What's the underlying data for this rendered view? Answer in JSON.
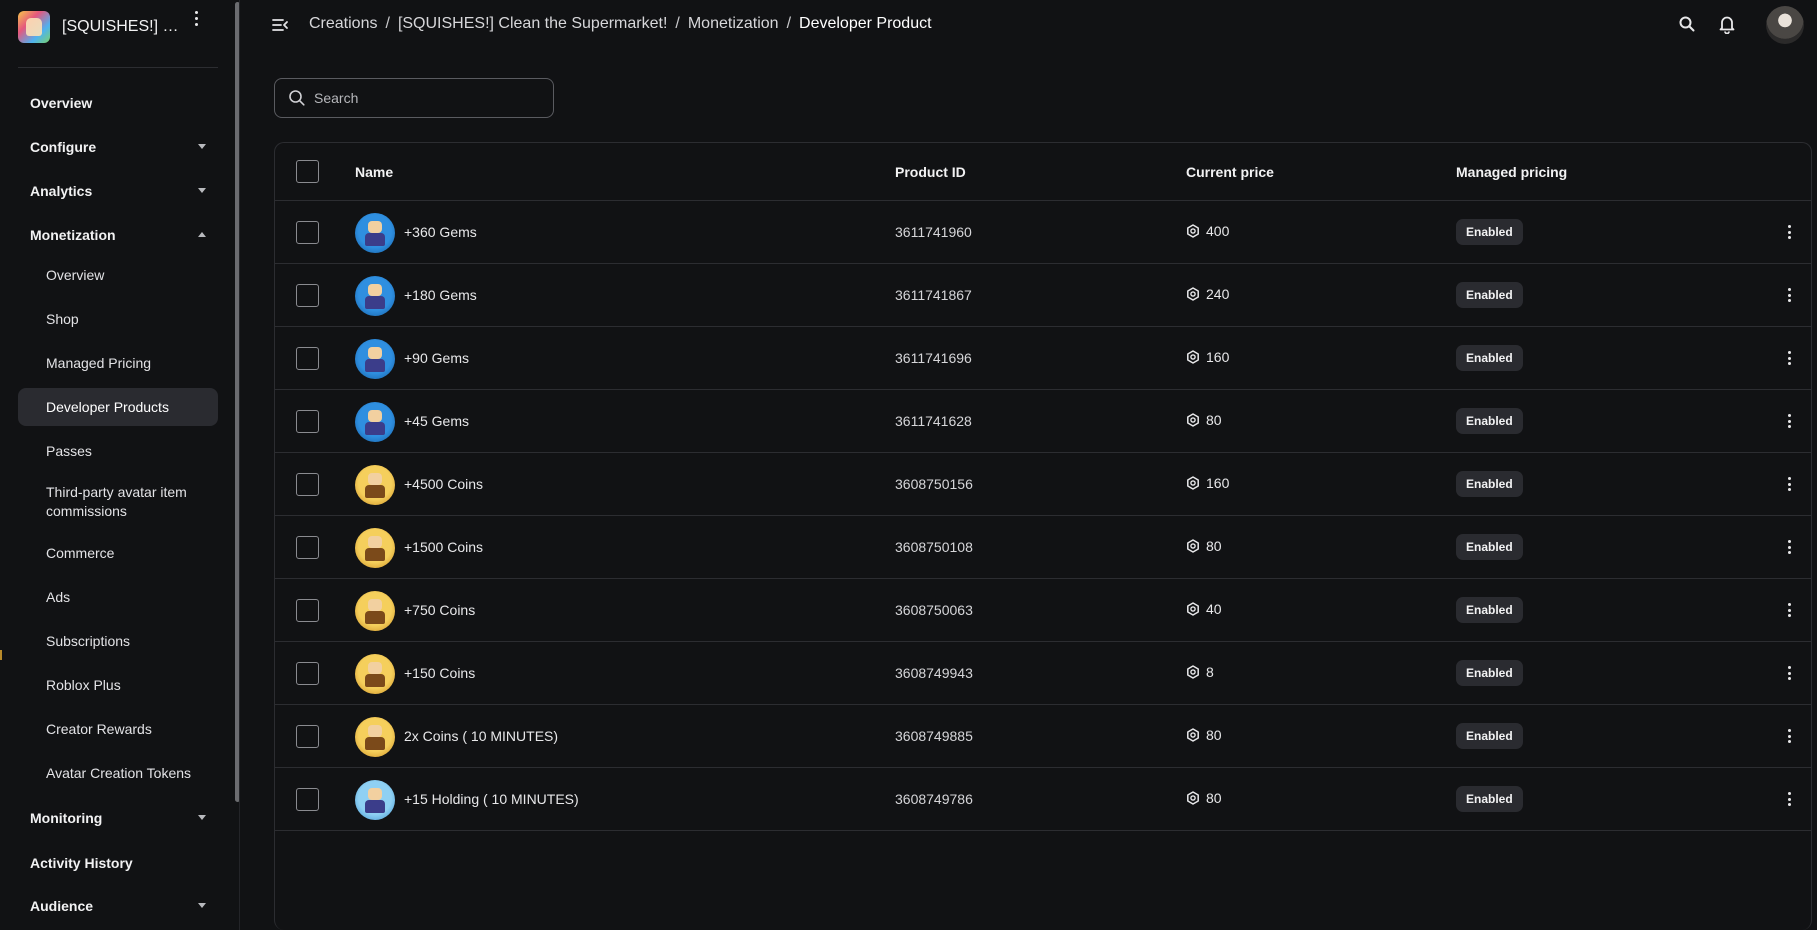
{
  "project": {
    "name": "[SQUISHES!] Clean the Supermarket!",
    "thumbnail_icon": "game-thumbnail-icon"
  },
  "sidebar": {
    "overview": "Overview",
    "configure": "Configure",
    "analytics": "Analytics",
    "monetization": "Monetization",
    "monetization_items": [
      "Overview",
      "Shop",
      "Managed Pricing",
      "Developer Products",
      "Passes",
      "Third-party avatar item commissions",
      "Commerce",
      "Ads",
      "Subscriptions",
      "Roblox Plus",
      "Creator Rewards",
      "Avatar Creation Tokens"
    ],
    "active_item": "Developer Products",
    "monitoring": "Monitoring",
    "activity_history": "Activity History",
    "audience": "Audience"
  },
  "breadcrumb": {
    "items": [
      "Creations",
      "[SQUISHES!] Clean the Supermarket!",
      "Monetization"
    ],
    "separator": "/",
    "current": "Developer Product"
  },
  "search": {
    "placeholder": "Search",
    "value": ""
  },
  "table": {
    "columns": {
      "name": "Name",
      "product_id": "Product ID",
      "current_price": "Current price",
      "managed_pricing": "Managed pricing"
    },
    "rows": [
      {
        "icon": "gem",
        "name": "+360 Gems",
        "id": "3611741960",
        "price": "400",
        "managed": "Enabled"
      },
      {
        "icon": "gem",
        "name": "+180 Gems",
        "id": "3611741867",
        "price": "240",
        "managed": "Enabled"
      },
      {
        "icon": "gem",
        "name": "+90 Gems",
        "id": "3611741696",
        "price": "160",
        "managed": "Enabled"
      },
      {
        "icon": "gem",
        "name": "+45 Gems",
        "id": "3611741628",
        "price": "80",
        "managed": "Enabled"
      },
      {
        "icon": "coin",
        "name": "+4500 Coins",
        "id": "3608750156",
        "price": "160",
        "managed": "Enabled"
      },
      {
        "icon": "coin",
        "name": "+1500 Coins",
        "id": "3608750108",
        "price": "80",
        "managed": "Enabled"
      },
      {
        "icon": "coin",
        "name": "+750 Coins",
        "id": "3608750063",
        "price": "40",
        "managed": "Enabled"
      },
      {
        "icon": "coin",
        "name": "+150 Coins",
        "id": "3608749943",
        "price": "8",
        "managed": "Enabled"
      },
      {
        "icon": "coin",
        "name": "2x Coins ( 10 MINUTES)",
        "id": "3608749885",
        "price": "80",
        "managed": "Enabled"
      },
      {
        "icon": "hold",
        "name": "+15 Holding ( 10 MINUTES)",
        "id": "3608749786",
        "price": "80",
        "managed": "Enabled"
      }
    ]
  },
  "colors": {
    "background": "#111214",
    "active_nav": "#2a2b30",
    "border": "#2c2d31",
    "badge_bg": "#2a2b30"
  }
}
